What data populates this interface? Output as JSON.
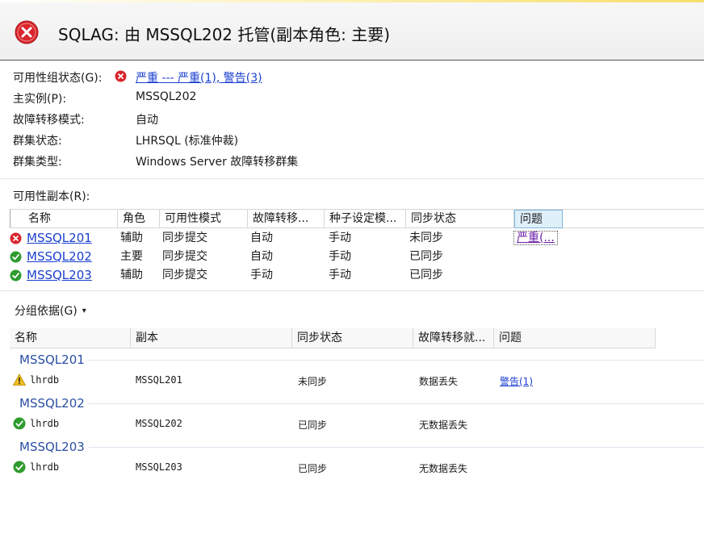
{
  "header": {
    "title": "SQLAG: 由 MSSQL202 托管(副本角色: 主要)",
    "icon": "error-icon"
  },
  "properties": {
    "ag_state_label": "可用性组状态(G):",
    "ag_state_value": "严重 --- 严重(1), 警告(3)",
    "primary_label": "主实例(P):",
    "primary_value": "MSSQL202",
    "failover_mode_label": "故障转移模式:",
    "failover_mode_value": "自动",
    "cluster_state_label": "群集状态:",
    "cluster_state_value": "LHRSQL (标准仲裁)",
    "cluster_type_label": "群集类型:",
    "cluster_type_value": "Windows Server 故障转移群集"
  },
  "replicas": {
    "section_label": "可用性副本(R):",
    "columns": [
      "名称",
      "角色",
      "可用性模式",
      "故障转移...",
      "种子设定模...",
      "同步状态",
      "问题"
    ],
    "rows": [
      {
        "status": "error",
        "name": "MSSQL201",
        "role": "辅助",
        "availability": "同步提交",
        "failover": "自动",
        "seeding": "手动",
        "sync": "未同步",
        "issue": "严重(..."
      },
      {
        "status": "ok",
        "name": "MSSQL202",
        "role": "主要",
        "availability": "同步提交",
        "failover": "自动",
        "seeding": "手动",
        "sync": "已同步",
        "issue": ""
      },
      {
        "status": "ok",
        "name": "MSSQL203",
        "role": "辅助",
        "availability": "同步提交",
        "failover": "手动",
        "seeding": "手动",
        "sync": "已同步",
        "issue": ""
      }
    ]
  },
  "groupby": {
    "label": "分组依据(G)"
  },
  "databases": {
    "columns": [
      "名称",
      "副本",
      "同步状态",
      "故障转移就...",
      "问题"
    ],
    "groups": [
      {
        "title": "MSSQL201",
        "status": "warning",
        "name": "lhrdb",
        "replica": "MSSQL201",
        "sync": "未同步",
        "failover_ready": "数据丢失",
        "issue": "警告(1)"
      },
      {
        "title": "MSSQL202",
        "status": "ok",
        "name": "lhrdb",
        "replica": "MSSQL202",
        "sync": "已同步",
        "failover_ready": "无数据丢失",
        "issue": ""
      },
      {
        "title": "MSSQL203",
        "status": "ok",
        "name": "lhrdb",
        "replica": "MSSQL203",
        "sync": "已同步",
        "failover_ready": "无数据丢失",
        "issue": ""
      }
    ]
  },
  "colors": {
    "error": "#d9252b",
    "ok": "#2e9b2e",
    "warning": "#f2c01e",
    "link": "#1a3fcf",
    "group_title": "#2a4fa5"
  }
}
